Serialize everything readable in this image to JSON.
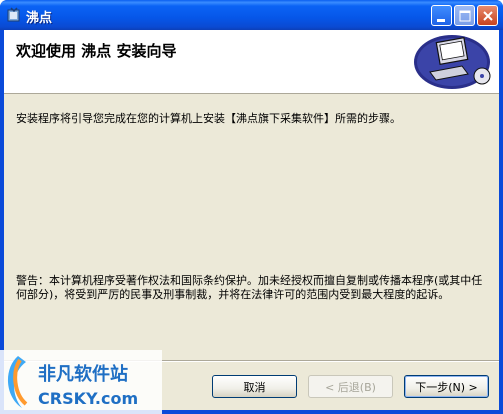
{
  "window": {
    "title": "沸点"
  },
  "banner": {
    "title": "欢迎使用 沸点 安装向导"
  },
  "content": {
    "intro": "安装程序将引导您完成在您的计算机上安装【沸点旗下采集软件】所需的步骤。",
    "warning": "警告：本计算机程序受著作权法和国际条约保护。加未经授权而擅自复制或传播本程序(或其中任何部分)，将受到严厉的民事及刑事制裁，并将在法律许可的范围内受到最大程度的起诉。"
  },
  "buttons": {
    "cancel": "取消",
    "back": "< 后退(B)",
    "next": "下一步(N) >"
  },
  "watermark": {
    "line1": "非凡软件站",
    "line2": "CRSKY.com"
  },
  "colors": {
    "titlebar": "#0a5ff0",
    "client": "#ece9d8",
    "close": "#c8431f"
  }
}
